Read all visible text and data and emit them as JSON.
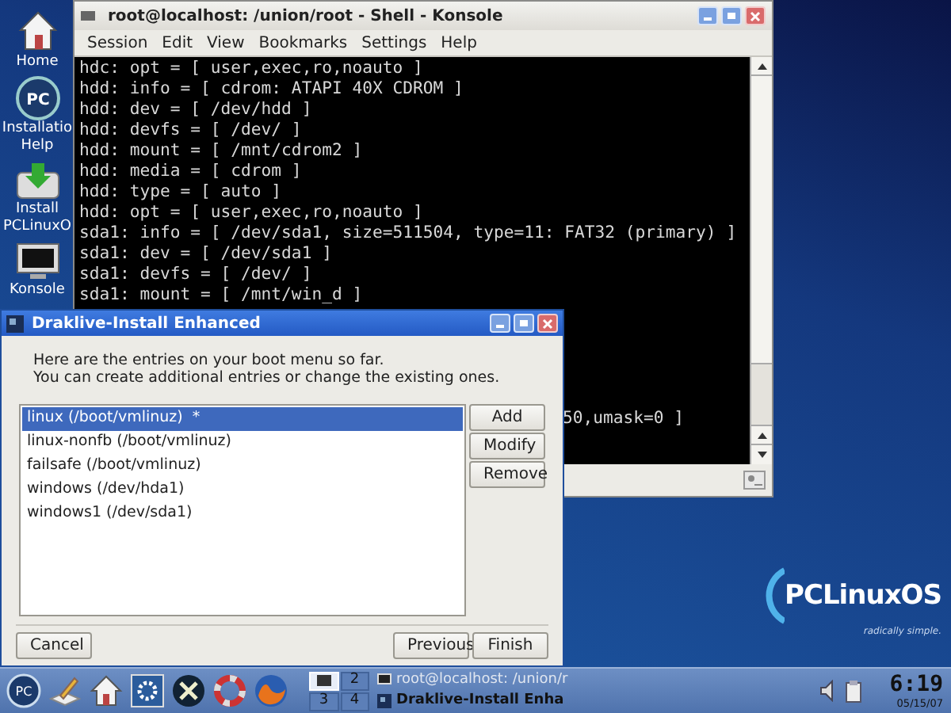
{
  "desktop_icons": [
    {
      "kind": "home",
      "label": "Home"
    },
    {
      "kind": "pc",
      "badge": "PC",
      "label": "Installatio Help"
    },
    {
      "kind": "install",
      "label": "Install PCLinuxO"
    },
    {
      "kind": "terminal",
      "label": "Konsole"
    }
  ],
  "konsole": {
    "title": "root@localhost: /union/root - Shell - Konsole",
    "menu": [
      "Session",
      "Edit",
      "View",
      "Bookmarks",
      "Settings",
      "Help"
    ],
    "lines": [
      "hdc: opt = [ user,exec,ro,noauto ]",
      "hdd: info = [ cdrom: ATAPI 40X CDROM ]",
      "hdd: dev = [ /dev/hdd ]",
      "hdd: devfs = [ /dev/ ]",
      "hdd: mount = [ /mnt/cdrom2 ]",
      "hdd: media = [ cdrom ]",
      "hdd: type = [ auto ]",
      "hdd: opt = [ user,exec,ro,noauto ]",
      "sda1: info = [ /dev/sda1, size=511504, type=11: FAT32 (primary) ]",
      "sda1: dev = [ /dev/sda1 ]",
      "sda1: devfs = [ /dev/ ]",
      "sda1: mount = [ /mnt/win_d ]"
    ],
    "partial_line": "50,umask=0 ]"
  },
  "dialog": {
    "title": "Draklive-Install Enhanced",
    "intro": [
      "Here are the entries on your boot menu so far.",
      "You can create additional entries or change the existing ones."
    ],
    "entries": [
      {
        "label": "linux (/boot/vmlinuz)  *",
        "selected": true
      },
      {
        "label": "linux-nonfb (/boot/vmlinuz)",
        "selected": false
      },
      {
        "label": "failsafe (/boot/vmlinuz)",
        "selected": false
      },
      {
        "label": "windows (/dev/hda1)",
        "selected": false
      },
      {
        "label": "windows1 (/dev/sda1)",
        "selected": false
      }
    ],
    "side_buttons": [
      "Add",
      "Modify",
      "Remove"
    ],
    "cancel": "Cancel",
    "previous": "Previous",
    "finish": "Finish"
  },
  "logo": {
    "name": "PCLinuxOS",
    "tagline": "radically simple."
  },
  "taskbar": {
    "start_badge": "PC",
    "pager": [
      {
        "selected": true
      },
      {
        "label": "2",
        "selected": false
      },
      {
        "label": "3",
        "selected": false
      },
      {
        "label": "4",
        "selected": false
      }
    ],
    "tasks": [
      {
        "kind": "terminal",
        "title": "root@localhost: /union/r",
        "selected": false
      },
      {
        "kind": "app",
        "title": "Draklive-Install Enha",
        "selected": true
      }
    ],
    "clock": "6:19",
    "date": "05/15/07"
  }
}
